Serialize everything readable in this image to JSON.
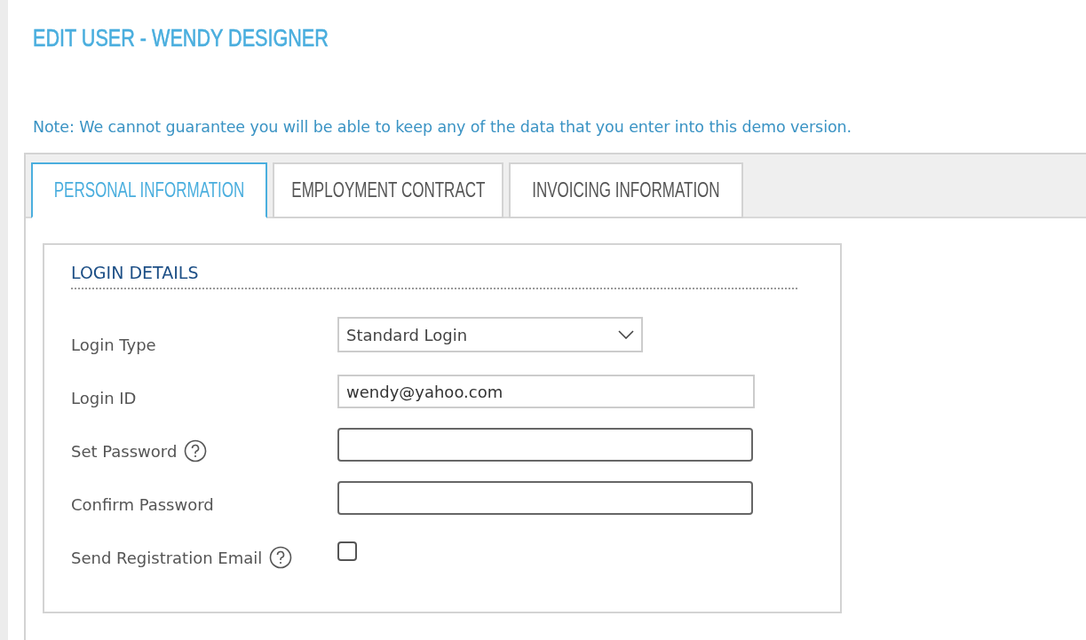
{
  "title": "EDIT USER - WENDY DESIGNER",
  "note": "Note: We cannot guarantee you will be able to keep any of the data that you enter into this demo version.",
  "tabs": [
    {
      "label": "PERSONAL INFORMATION",
      "selected": true
    },
    {
      "label": "EMPLOYMENT CONTRACT",
      "selected": false
    },
    {
      "label": "INVOICING INFORMATION",
      "selected": false
    }
  ],
  "section": {
    "title": "LOGIN DETAILS",
    "fields": [
      {
        "kind": "select",
        "label": "Login Type",
        "help": false,
        "value": "Standard Login"
      },
      {
        "kind": "text",
        "label": "Login ID",
        "help": false,
        "value": "wendy@yahoo.com"
      },
      {
        "kind": "password",
        "label": "Set Password",
        "help": true
      },
      {
        "kind": "password",
        "label": "Confirm Password",
        "help": false
      },
      {
        "kind": "checkbox",
        "label": "Send Registration Email",
        "help": true,
        "checked": false
      }
    ]
  }
}
